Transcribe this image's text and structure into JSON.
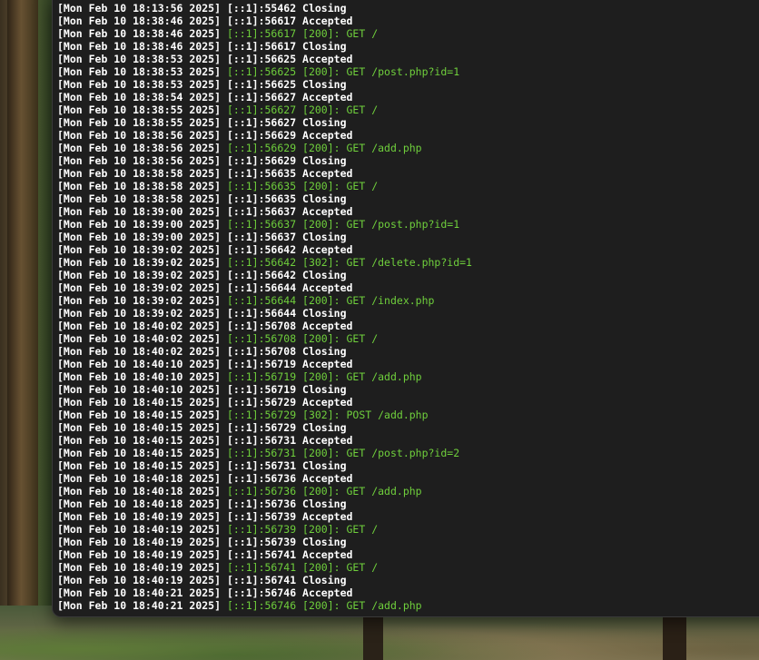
{
  "colors": {
    "terminal_background": "#1e1e1e",
    "text_default": "#ffffff",
    "text_request": "#6fcf3c"
  },
  "log_lines": [
    {
      "ts": "[Mon Feb 10 18:13:56 2025]",
      "msg": "[::1]:55462 Closing",
      "kind": "plain"
    },
    {
      "ts": "[Mon Feb 10 18:38:46 2025]",
      "msg": "[::1]:56617 Accepted",
      "kind": "plain"
    },
    {
      "ts": "[Mon Feb 10 18:38:46 2025]",
      "msg": "[::1]:56617 [200]: GET /",
      "kind": "req"
    },
    {
      "ts": "[Mon Feb 10 18:38:46 2025]",
      "msg": "[::1]:56617 Closing",
      "kind": "plain"
    },
    {
      "ts": "[Mon Feb 10 18:38:53 2025]",
      "msg": "[::1]:56625 Accepted",
      "kind": "plain"
    },
    {
      "ts": "[Mon Feb 10 18:38:53 2025]",
      "msg": "[::1]:56625 [200]: GET /post.php?id=1",
      "kind": "req"
    },
    {
      "ts": "[Mon Feb 10 18:38:53 2025]",
      "msg": "[::1]:56625 Closing",
      "kind": "plain"
    },
    {
      "ts": "[Mon Feb 10 18:38:54 2025]",
      "msg": "[::1]:56627 Accepted",
      "kind": "plain"
    },
    {
      "ts": "[Mon Feb 10 18:38:55 2025]",
      "msg": "[::1]:56627 [200]: GET /",
      "kind": "req"
    },
    {
      "ts": "[Mon Feb 10 18:38:55 2025]",
      "msg": "[::1]:56627 Closing",
      "kind": "plain"
    },
    {
      "ts": "[Mon Feb 10 18:38:56 2025]",
      "msg": "[::1]:56629 Accepted",
      "kind": "plain"
    },
    {
      "ts": "[Mon Feb 10 18:38:56 2025]",
      "msg": "[::1]:56629 [200]: GET /add.php",
      "kind": "req"
    },
    {
      "ts": "[Mon Feb 10 18:38:56 2025]",
      "msg": "[::1]:56629 Closing",
      "kind": "plain"
    },
    {
      "ts": "[Mon Feb 10 18:38:58 2025]",
      "msg": "[::1]:56635 Accepted",
      "kind": "plain"
    },
    {
      "ts": "[Mon Feb 10 18:38:58 2025]",
      "msg": "[::1]:56635 [200]: GET /",
      "kind": "req"
    },
    {
      "ts": "[Mon Feb 10 18:38:58 2025]",
      "msg": "[::1]:56635 Closing",
      "kind": "plain"
    },
    {
      "ts": "[Mon Feb 10 18:39:00 2025]",
      "msg": "[::1]:56637 Accepted",
      "kind": "plain"
    },
    {
      "ts": "[Mon Feb 10 18:39:00 2025]",
      "msg": "[::1]:56637 [200]: GET /post.php?id=1",
      "kind": "req"
    },
    {
      "ts": "[Mon Feb 10 18:39:00 2025]",
      "msg": "[::1]:56637 Closing",
      "kind": "plain"
    },
    {
      "ts": "[Mon Feb 10 18:39:02 2025]",
      "msg": "[::1]:56642 Accepted",
      "kind": "plain"
    },
    {
      "ts": "[Mon Feb 10 18:39:02 2025]",
      "msg": "[::1]:56642 [302]: GET /delete.php?id=1",
      "kind": "req"
    },
    {
      "ts": "[Mon Feb 10 18:39:02 2025]",
      "msg": "[::1]:56642 Closing",
      "kind": "plain"
    },
    {
      "ts": "[Mon Feb 10 18:39:02 2025]",
      "msg": "[::1]:56644 Accepted",
      "kind": "plain"
    },
    {
      "ts": "[Mon Feb 10 18:39:02 2025]",
      "msg": "[::1]:56644 [200]: GET /index.php",
      "kind": "req"
    },
    {
      "ts": "[Mon Feb 10 18:39:02 2025]",
      "msg": "[::1]:56644 Closing",
      "kind": "plain"
    },
    {
      "ts": "[Mon Feb 10 18:40:02 2025]",
      "msg": "[::1]:56708 Accepted",
      "kind": "plain"
    },
    {
      "ts": "[Mon Feb 10 18:40:02 2025]",
      "msg": "[::1]:56708 [200]: GET /",
      "kind": "req"
    },
    {
      "ts": "[Mon Feb 10 18:40:02 2025]",
      "msg": "[::1]:56708 Closing",
      "kind": "plain"
    },
    {
      "ts": "[Mon Feb 10 18:40:10 2025]",
      "msg": "[::1]:56719 Accepted",
      "kind": "plain"
    },
    {
      "ts": "[Mon Feb 10 18:40:10 2025]",
      "msg": "[::1]:56719 [200]: GET /add.php",
      "kind": "req"
    },
    {
      "ts": "[Mon Feb 10 18:40:10 2025]",
      "msg": "[::1]:56719 Closing",
      "kind": "plain"
    },
    {
      "ts": "[Mon Feb 10 18:40:15 2025]",
      "msg": "[::1]:56729 Accepted",
      "kind": "plain"
    },
    {
      "ts": "[Mon Feb 10 18:40:15 2025]",
      "msg": "[::1]:56729 [302]: POST /add.php",
      "kind": "req"
    },
    {
      "ts": "[Mon Feb 10 18:40:15 2025]",
      "msg": "[::1]:56729 Closing",
      "kind": "plain"
    },
    {
      "ts": "[Mon Feb 10 18:40:15 2025]",
      "msg": "[::1]:56731 Accepted",
      "kind": "plain"
    },
    {
      "ts": "[Mon Feb 10 18:40:15 2025]",
      "msg": "[::1]:56731 [200]: GET /post.php?id=2",
      "kind": "req"
    },
    {
      "ts": "[Mon Feb 10 18:40:15 2025]",
      "msg": "[::1]:56731 Closing",
      "kind": "plain"
    },
    {
      "ts": "[Mon Feb 10 18:40:18 2025]",
      "msg": "[::1]:56736 Accepted",
      "kind": "plain"
    },
    {
      "ts": "[Mon Feb 10 18:40:18 2025]",
      "msg": "[::1]:56736 [200]: GET /add.php",
      "kind": "req"
    },
    {
      "ts": "[Mon Feb 10 18:40:18 2025]",
      "msg": "[::1]:56736 Closing",
      "kind": "plain"
    },
    {
      "ts": "[Mon Feb 10 18:40:19 2025]",
      "msg": "[::1]:56739 Accepted",
      "kind": "plain"
    },
    {
      "ts": "[Mon Feb 10 18:40:19 2025]",
      "msg": "[::1]:56739 [200]: GET /",
      "kind": "req"
    },
    {
      "ts": "[Mon Feb 10 18:40:19 2025]",
      "msg": "[::1]:56739 Closing",
      "kind": "plain"
    },
    {
      "ts": "[Mon Feb 10 18:40:19 2025]",
      "msg": "[::1]:56741 Accepted",
      "kind": "plain"
    },
    {
      "ts": "[Mon Feb 10 18:40:19 2025]",
      "msg": "[::1]:56741 [200]: GET /",
      "kind": "req"
    },
    {
      "ts": "[Mon Feb 10 18:40:19 2025]",
      "msg": "[::1]:56741 Closing",
      "kind": "plain"
    },
    {
      "ts": "[Mon Feb 10 18:40:21 2025]",
      "msg": "[::1]:56746 Accepted",
      "kind": "plain"
    },
    {
      "ts": "[Mon Feb 10 18:40:21 2025]",
      "msg": "[::1]:56746 [200]: GET /add.php",
      "kind": "req"
    }
  ]
}
